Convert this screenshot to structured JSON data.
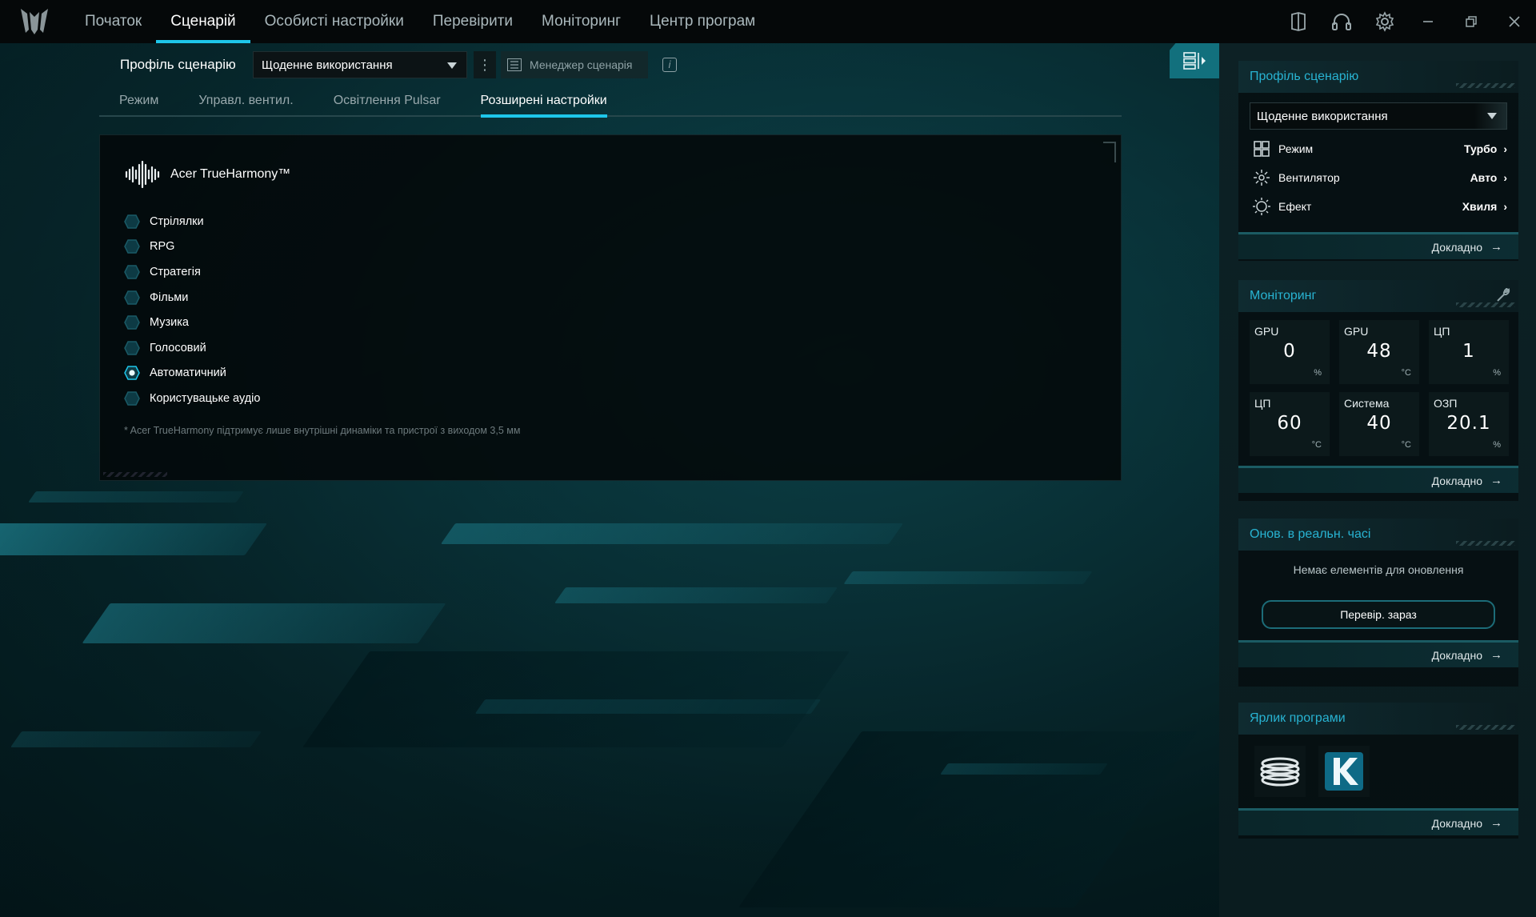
{
  "nav": {
    "items": [
      "Початок",
      "Сценарій",
      "Особисті настройки",
      "Перевірити",
      "Моніторинг",
      "Центр програм"
    ],
    "active_index": 1
  },
  "scenario": {
    "profile_label": "Профіль сценарію",
    "profile_value": "Щоденне використання",
    "manager_label": "Менеджер сценарія",
    "tabs": [
      "Режим",
      "Управл. вентил.",
      "Освітлення Pulsar",
      "Розширені настройки"
    ],
    "active_tab": 3
  },
  "trueharmony": {
    "title": "Acer TrueHarmony™",
    "options": [
      "Стрілялки",
      "RPG",
      "Стратегія",
      "Фільми",
      "Музика",
      "Голосовий",
      "Автоматичний",
      "Користувацьке аудіо"
    ],
    "selected": "Автоматичний",
    "footnote": "* Acer TrueHarmony підтримує лише внутрішні динаміки та пристрої з виходом 3,5 мм"
  },
  "sidebar": {
    "profile_card": {
      "title": "Профіль сценарію",
      "select_value": "Щоденне використання",
      "rows": [
        {
          "label": "Режим",
          "value": "Турбо",
          "icon": "mode-grid-icon"
        },
        {
          "label": "Вентилятор",
          "value": "Авто",
          "icon": "fan-icon"
        },
        {
          "label": "Ефект",
          "value": "Хвиля",
          "icon": "effect-sun-icon"
        }
      ],
      "more": "Докладно"
    },
    "monitor_card": {
      "title": "Моніторинг",
      "cells": [
        {
          "label": "GPU",
          "value": "0",
          "unit": "%"
        },
        {
          "label": "GPU",
          "value": "48",
          "unit": "°C"
        },
        {
          "label": "ЦП",
          "value": "1",
          "unit": "%"
        },
        {
          "label": "ЦП",
          "value": "60",
          "unit": "°C"
        },
        {
          "label": "Система",
          "value": "40",
          "unit": "°C"
        },
        {
          "label": "ОЗП",
          "value": "20.1",
          "unit": "%"
        }
      ],
      "more": "Докладно"
    },
    "update_card": {
      "title": "Онов. в реальн. часі",
      "message": "Немає елементів для оновлення",
      "button": "Перевір. зараз",
      "more": "Докладно"
    },
    "apps_card": {
      "title": "Ярлик програми",
      "apps": [
        "coil-app-icon",
        "k-app-icon"
      ],
      "more": "Докладно"
    }
  },
  "colors": {
    "accent": "#1ec6ea",
    "card_title": "#28b3d2",
    "topbar": "#050809"
  }
}
